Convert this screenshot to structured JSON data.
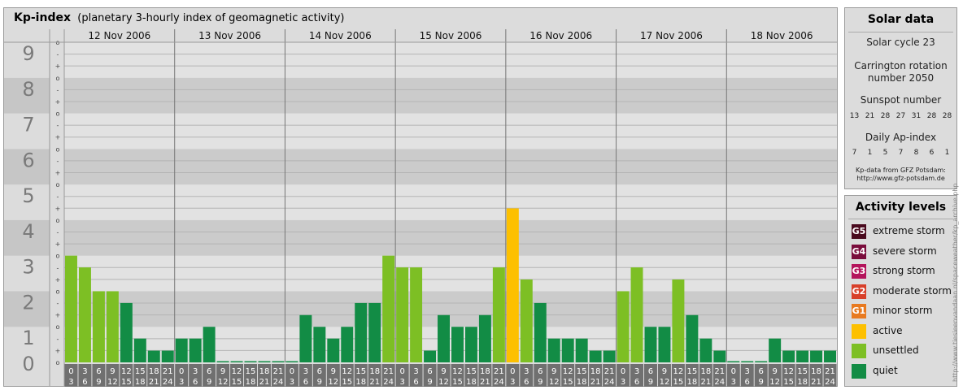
{
  "header": {
    "title": "Kp-index",
    "subtitle": "(planetary 3-hourly index of geomagnetic activity)"
  },
  "chart_data": {
    "type": "bar",
    "title": "Kp-index",
    "subtitle": "(planetary 3-hourly index of geomagnetic activity)",
    "ylim": [
      0,
      9
    ],
    "y_ticks": [
      "0",
      "1",
      "2",
      "3",
      "4",
      "5",
      "6",
      "7",
      "8",
      "9"
    ],
    "minor_tick_labels": [
      "o",
      "+",
      "-"
    ],
    "days": [
      "12 Nov 2006",
      "13 Nov 2006",
      "14 Nov 2006",
      "15 Nov 2006",
      "16 Nov 2006",
      "17 Nov 2006",
      "18 Nov 2006"
    ],
    "interval_starts": [
      "0",
      "3",
      "6",
      "9",
      "12",
      "15",
      "18",
      "21"
    ],
    "interval_ends": [
      "3",
      "6",
      "9",
      "12",
      "15",
      "18",
      "21",
      "24"
    ],
    "values": [
      [
        3.0,
        2.67,
        2.0,
        2.0,
        1.67,
        0.67,
        0.33,
        0.33
      ],
      [
        0.67,
        0.67,
        1.0,
        0.0,
        0.0,
        0.0,
        0.0,
        0.0
      ],
      [
        0.0,
        1.33,
        1.0,
        0.67,
        1.0,
        1.67,
        1.67,
        3.0
      ],
      [
        2.67,
        2.67,
        0.33,
        1.33,
        1.0,
        1.0,
        1.33,
        2.67
      ],
      [
        4.33,
        2.33,
        1.67,
        0.67,
        0.67,
        0.67,
        0.33,
        0.33
      ],
      [
        2.0,
        2.67,
        1.0,
        1.0,
        2.33,
        1.33,
        0.67,
        0.33
      ],
      [
        0.0,
        0.0,
        0.0,
        0.67,
        0.33,
        0.33,
        0.33,
        0.33
      ]
    ],
    "colors": {
      "quiet": "#128c45",
      "unsettled": "#7dbf24",
      "active": "#fdc000"
    }
  },
  "solar": {
    "title": "Solar data",
    "cycle": "Solar cycle 23",
    "carrington_line1": "Carrington rotation",
    "carrington_line2": "number 2050",
    "sunspot_title": "Sunspot number",
    "sunspot_values": [
      "13",
      "21",
      "28",
      "27",
      "31",
      "28",
      "28"
    ],
    "ap_title": "Daily Ap-index",
    "ap_values": [
      "7",
      "1",
      "5",
      "7",
      "8",
      "6",
      "1"
    ],
    "source_line1": "Kp-data from GFZ Potsdam:",
    "source_line2": "http://www.gfz-potsdam.de"
  },
  "activity": {
    "title": "Activity levels",
    "levels": [
      {
        "badge": "G5",
        "label": "extreme storm",
        "color": "#4a0a1e"
      },
      {
        "badge": "G4",
        "label": "severe storm",
        "color": "#7a0c3c"
      },
      {
        "badge": "G3",
        "label": "strong storm",
        "color": "#b4145c"
      },
      {
        "badge": "G2",
        "label": "moderate storm",
        "color": "#d8402a"
      },
      {
        "badge": "G1",
        "label": "minor storm",
        "color": "#e87a20"
      },
      {
        "badge": "",
        "label": "active",
        "color": "#fdc000"
      },
      {
        "badge": "",
        "label": "unsettled",
        "color": "#7dbf24"
      },
      {
        "badge": "",
        "label": "quiet",
        "color": "#128c45"
      }
    ]
  },
  "watermark": "http://www.tiesieenvandaan.nl/spaceweather/kp_archive.php"
}
